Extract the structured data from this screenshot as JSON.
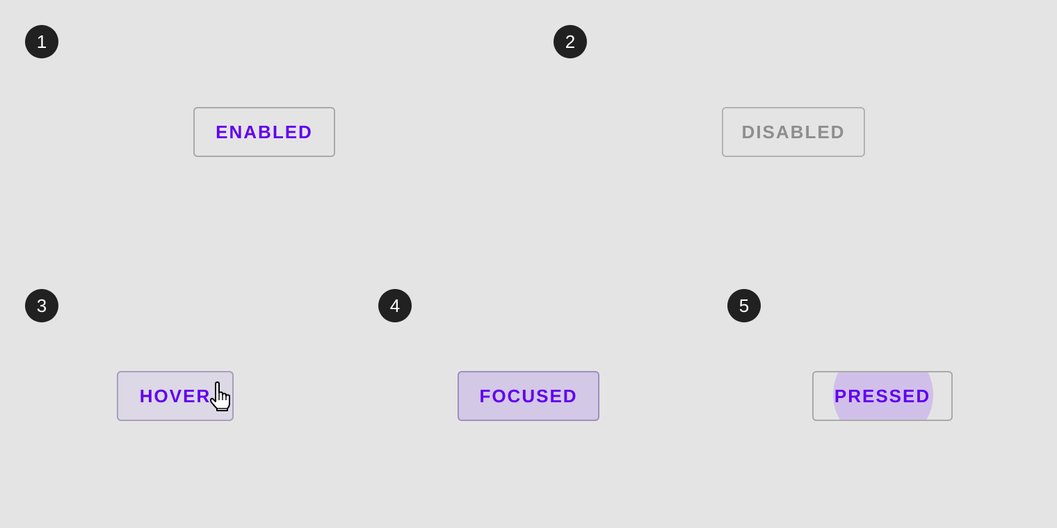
{
  "panels": [
    {
      "number": "1",
      "button_label": "ENABLED"
    },
    {
      "number": "2",
      "button_label": "DISABLED"
    },
    {
      "number": "3",
      "button_label": "HOVER"
    },
    {
      "number": "4",
      "button_label": "FOCUSED"
    },
    {
      "number": "5",
      "button_label": "PRESSED"
    }
  ],
  "colors": {
    "background": "#e4e4e4",
    "accent": "#6200ee",
    "disabled_text": "#8e8e8e",
    "badge": "#212121",
    "outline": "#a9a9a9"
  },
  "icons": {
    "cursor": "hand-pointer-icon"
  }
}
